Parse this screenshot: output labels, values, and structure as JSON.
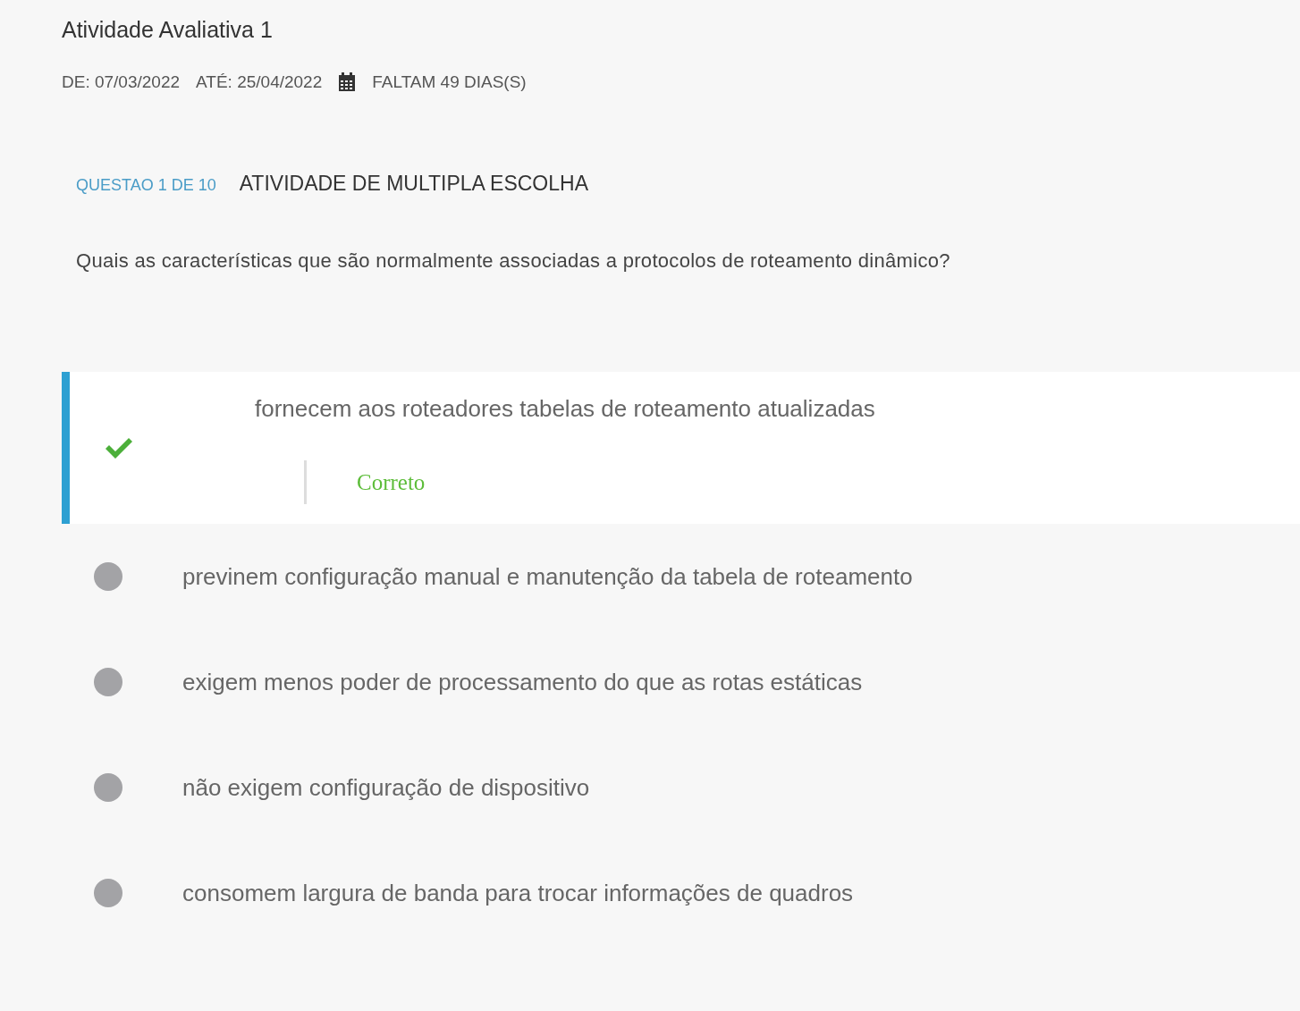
{
  "activity": {
    "title": "Atividade Avaliativa 1",
    "start": "DE: 07/03/2022",
    "end": "ATÉ: 25/04/2022",
    "remaining": "FALTAM 49 DIAS(S)"
  },
  "question": {
    "counter": "QUESTAO 1 DE 10",
    "type": "ATIVIDADE DE MULTIPLA ESCOLHA",
    "text": "Quais as características que são normalmente associadas a protocolos de roteamento dinâmico?"
  },
  "options": [
    {
      "text": "fornecem aos roteadores tabelas de roteamento atualizadas",
      "selected": true,
      "feedback": "Correto"
    },
    {
      "text": "previnem configuração manual e manutenção da tabela de roteamento",
      "selected": false
    },
    {
      "text": "exigem menos poder de processamento do que as rotas estáticas",
      "selected": false
    },
    {
      "text": "não exigem configuração de dispositivo",
      "selected": false
    },
    {
      "text": "consomem largura de banda para trocar informações de quadros",
      "selected": false
    }
  ]
}
